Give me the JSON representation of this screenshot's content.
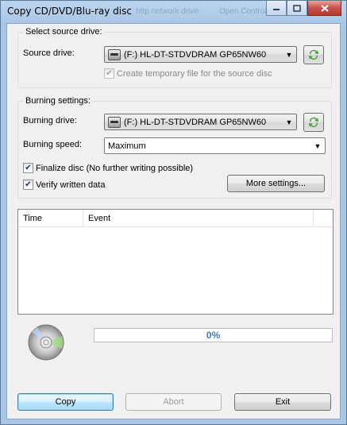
{
  "window": {
    "title": "Copy CD/DVD/Blu-ray disc",
    "bg_ghost_1": "http network drive",
    "bg_ghost_2": "Open Control Pa",
    "minimize_icon": "minimize-icon",
    "maximize_icon": "maximize-icon",
    "close_icon": "close-icon"
  },
  "source_group": {
    "legend": "Select source drive:",
    "drive_label": "Source drive:",
    "drive_value": "(F:) HL-DT-STDVDRAM GP65NW60",
    "temp_file_label": "Create temporary file for the source disc",
    "temp_file_checked": true,
    "temp_file_enabled": false
  },
  "burn_group": {
    "legend": "Burning settings:",
    "drive_label": "Burning drive:",
    "drive_value": "(F:) HL-DT-STDVDRAM GP65NW60",
    "speed_label": "Burning speed:",
    "speed_value": "Maximum",
    "finalize_label": "Finalize disc (No further writing possible)",
    "finalize_checked": true,
    "verify_label": "Verify written data",
    "verify_checked": true,
    "more_settings_label": "More settings..."
  },
  "log": {
    "columns": [
      "Time",
      "Event"
    ],
    "rows": []
  },
  "progress": {
    "text": "0%",
    "value": 0
  },
  "buttons": {
    "copy": "Copy",
    "abort": "Abort",
    "exit": "Exit"
  },
  "colors": {
    "accent": "#3a7fc4",
    "refresh_green": "#3a9a2a"
  }
}
